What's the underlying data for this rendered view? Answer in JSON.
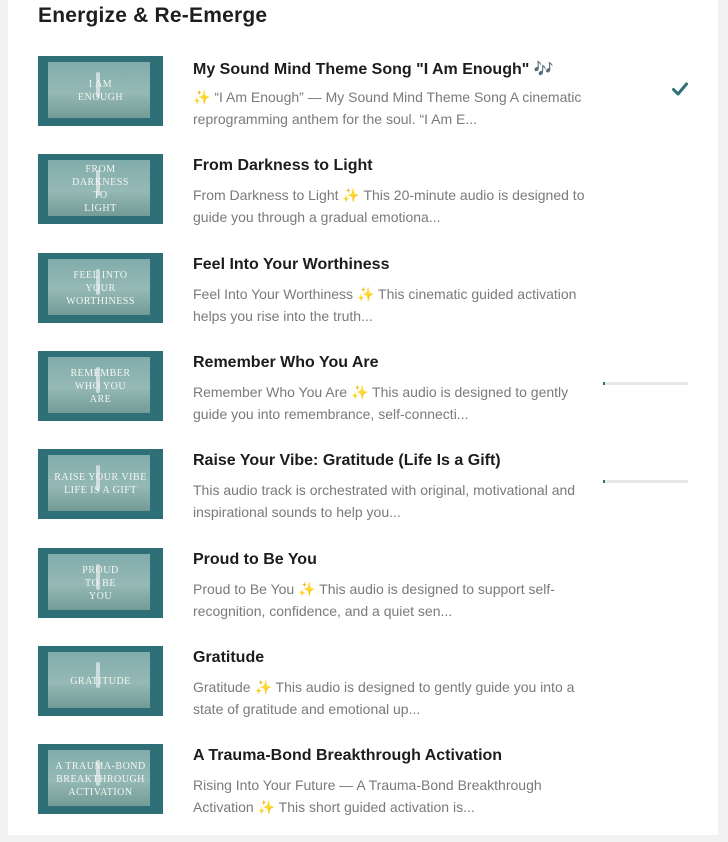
{
  "section": {
    "title": "Energize & Re-Emerge"
  },
  "colors": {
    "accent": "#2f6f78",
    "text": "#1c1c1c",
    "muted": "#7a7a7a"
  },
  "tracks": [
    {
      "thumb_text": "I AM\nENOUGH",
      "title": "My Sound Mind Theme Song \"I Am Enough\" 🎶",
      "description": "✨ “I Am Enough” — My Sound Mind Theme Song A cinematic reprogramming anthem for the soul. “I Am E...",
      "status": "completed",
      "status_icon": "checkmark-icon"
    },
    {
      "thumb_text": "FROM\nDARKNESS\nTO\nLIGHT",
      "title": "From Darkness to Light",
      "description": "From Darkness to Light ✨ This 20-minute audio is designed to guide you through a gradual emotiona...",
      "status": "none"
    },
    {
      "thumb_text": "FEEL INTO\nYOUR\nWORTHINESS",
      "title": "Feel Into Your Worthiness",
      "description": "Feel Into Your Worthiness ✨ This cinematic guided activation helps you rise into the truth...",
      "status": "none"
    },
    {
      "thumb_text": "REMEMBER\nWHO YOU\nARE",
      "title": "Remember Who You Are",
      "description": "Remember Who You Are ✨ This audio is designed to gently guide you into remembrance, self-connecti...",
      "status": "in-progress",
      "progress": 0.02
    },
    {
      "thumb_text": "RAISE YOUR VIBE\nLIFE IS A GIFT",
      "title": "Raise Your Vibe: Gratitude (Life Is a Gift)",
      "description": "This audio track is orchestrated with original, motivational and inspirational sounds to help you...",
      "status": "in-progress",
      "progress": 0.02
    },
    {
      "thumb_text": "PROUD\nTO BE\nYOU",
      "title": "Proud to Be You",
      "description": "Proud to Be You ✨ This audio is designed to support self-recognition, confidence, and a quiet sen...",
      "status": "none"
    },
    {
      "thumb_text": "GRATITUDE",
      "title": "Gratitude",
      "description": "Gratitude ✨ This audio is designed to gently guide you into a state of gratitude and emotional up...",
      "status": "none"
    },
    {
      "thumb_text": "A TRAUMA-BOND\nBREAKTHROUGH\nACTIVATION",
      "title": "A Trauma-Bond Breakthrough Activation",
      "description": "Rising Into Your Future — A Trauma-Bond Breakthrough Activation ✨ This short guided activation is...",
      "status": "none"
    }
  ]
}
